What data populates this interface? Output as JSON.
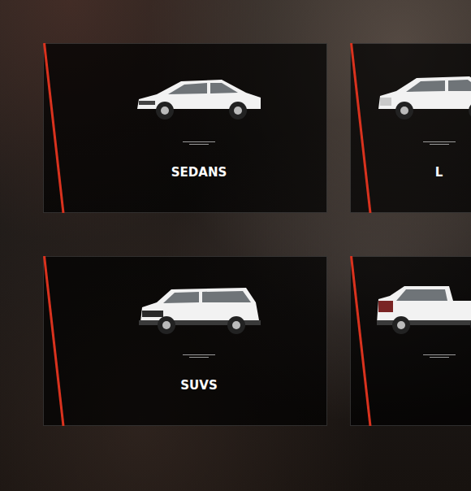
{
  "categories": [
    {
      "label": "SEDANS",
      "kind": "sedan"
    },
    {
      "label": "L",
      "kind": "luxury"
    },
    {
      "label": "SUVS",
      "kind": "suv"
    },
    {
      "kind": "truck"
    }
  ]
}
